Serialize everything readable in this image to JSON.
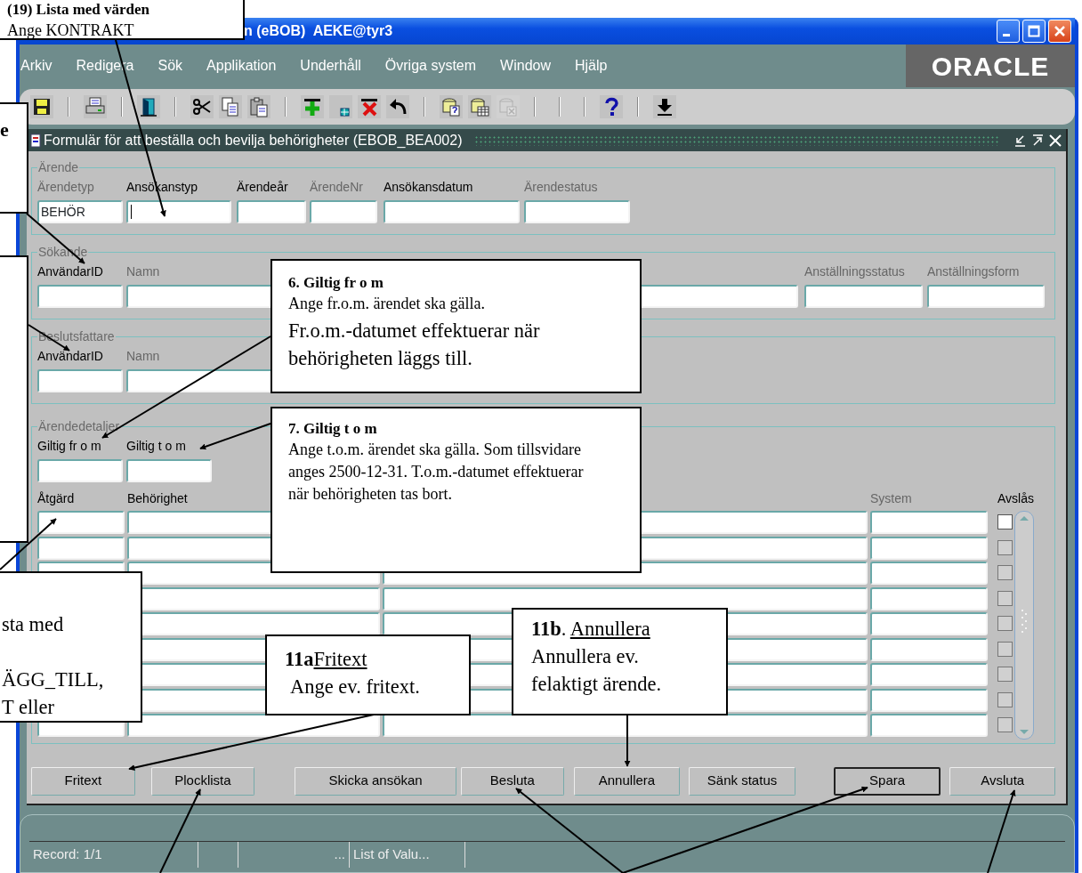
{
  "window": {
    "title": "n (eBOB)  AEKE@tyr3"
  },
  "menu": [
    "Arkiv",
    "Redigera",
    "Sök",
    "Applikation",
    "Underhåll",
    "Övriga system",
    "Window",
    "Hjälp"
  ],
  "logo": "ORACLE",
  "toolbar": [
    {
      "kind": "save",
      "disabled": false
    },
    {
      "kind": "separator"
    },
    {
      "kind": "print",
      "disabled": false
    },
    {
      "kind": "separator"
    },
    {
      "kind": "exit",
      "disabled": false
    },
    {
      "kind": "separator"
    },
    {
      "kind": "cut",
      "disabled": false
    },
    {
      "kind": "copy",
      "disabled": false
    },
    {
      "kind": "paste",
      "disabled": false
    },
    {
      "kind": "separator"
    },
    {
      "kind": "insert",
      "disabled": false
    },
    {
      "kind": "clear",
      "disabled": false
    },
    {
      "kind": "delete",
      "disabled": false
    },
    {
      "kind": "undo",
      "disabled": false
    },
    {
      "kind": "separator"
    },
    {
      "kind": "query",
      "disabled": false
    },
    {
      "kind": "fetch",
      "disabled": false
    },
    {
      "kind": "cancel",
      "disabled": true
    },
    {
      "kind": "separator"
    },
    {
      "kind": "separator"
    },
    {
      "kind": "separator"
    },
    {
      "kind": "help",
      "disabled": false
    },
    {
      "kind": "separator"
    },
    {
      "kind": "download",
      "disabled": false
    }
  ],
  "form": {
    "title": "Formulär för att beställa och bevilja behörigheter (EBOB_BEA002)"
  },
  "sections": [
    {
      "legend": "Ärende",
      "fields": [
        {
          "label": "Ärendetyp",
          "dimmed": true,
          "value": "BEHÖR",
          "focused": false
        },
        {
          "label": "Ansökanstyp",
          "dimmed": false,
          "focused": true
        },
        {
          "label": "Ärendeår",
          "dimmed": false,
          "focused": false
        },
        {
          "label": "ÄrendeNr",
          "dimmed": true,
          "focused": false
        },
        {
          "label": "Ansökansdatum",
          "dimmed": false,
          "focused": false
        },
        {
          "label": "Ärendestatus",
          "dimmed": true,
          "focused": false
        }
      ]
    },
    {
      "legend": "Sökande",
      "fields": [
        {
          "label": "AnvändarID",
          "dimmed": false,
          "focused": false
        },
        {
          "label": "Namn",
          "dimmed": true,
          "focused": false
        },
        {
          "label": "Anställningsstatus",
          "dimmed": true,
          "focused": false
        },
        {
          "label": "Anställningsform",
          "dimmed": true,
          "focused": false
        }
      ]
    },
    {
      "legend": "Beslutsfattare",
      "fields": [
        {
          "label": "AnvändarID",
          "dimmed": false,
          "focused": false
        },
        {
          "label": "Namn",
          "dimmed": true,
          "focused": false
        }
      ]
    },
    {
      "legend": "Ärendedetaljer",
      "fields": [
        {
          "label": "Giltig fr o m",
          "dimmed": false,
          "focused": false
        },
        {
          "label": "Giltig t o m",
          "dimmed": false,
          "focused": false
        }
      ]
    }
  ],
  "table": {
    "columns": [
      {
        "label": "Åtgärd",
        "dimmed": false
      },
      {
        "label": "Behörighet",
        "dimmed": false
      },
      {
        "label": "System",
        "dimmed": true
      },
      {
        "label": "Avslås",
        "dimmed": false
      }
    ],
    "rows": [
      {
        "checked": false,
        "disabled": false
      },
      {
        "checked": false,
        "disabled": true
      },
      {
        "checked": false,
        "disabled": true
      },
      {
        "checked": false,
        "disabled": true
      },
      {
        "checked": false,
        "disabled": true
      },
      {
        "checked": false,
        "disabled": true
      },
      {
        "checked": false,
        "disabled": true
      },
      {
        "checked": false,
        "disabled": true
      },
      {
        "checked": false,
        "disabled": true
      }
    ]
  },
  "buttons": [
    {
      "label": "Fritext",
      "focused": false
    },
    {
      "label": "Plocklista",
      "focused": false
    },
    {
      "label": "Skicka ansökan",
      "focused": false
    },
    {
      "label": "Besluta",
      "focused": false
    },
    {
      "label": "Annullera",
      "focused": false
    },
    {
      "label": "Sänk status",
      "focused": false
    },
    {
      "label": "Spara",
      "focused": true
    },
    {
      "label": "Avsluta",
      "focused": false
    }
  ],
  "status_bar": {
    "record": "Record: 1/1",
    "ellipsis": "...",
    "list": "List of Valu..."
  },
  "callouts": [
    {
      "kind": "note",
      "lines": [
        {
          "kind": "heading",
          "text": "(19) Lista med värden"
        },
        {
          "kind": "body",
          "text": "Ange KONTRAKT"
        }
      ]
    },
    {
      "kind": "note",
      "lines": [
        {
          "kind": "heading",
          "text": "e"
        }
      ]
    },
    {
      "kind": "blank"
    },
    {
      "kind": "note",
      "lines": [
        {
          "kind": "heading",
          "text": "6. Giltig fr o m"
        },
        {
          "kind": "body",
          "text": "Ange fr.o.m. ärendet ska gälla."
        },
        {
          "kind": "large",
          "text": "Fr.o.m.-datumet effektuerar när behörigheten läggs till."
        }
      ]
    },
    {
      "kind": "note",
      "lines": [
        {
          "kind": "heading",
          "text": "7. Giltig t o m"
        },
        {
          "kind": "body",
          "text": "Ange t.o.m. ärendet ska gälla. Som tillsvidare anges 2500-12-31. T.o.m.-datumet effektuerar när behörigheten tas bort."
        }
      ]
    },
    {
      "kind": "note",
      "lines": [
        {
          "kind": "large",
          "text": "sta med"
        },
        {
          "kind": "large",
          "text": "ÄGG_TILL,"
        },
        {
          "kind": "large",
          "text": "T eller"
        }
      ]
    },
    {
      "kind": "note",
      "lines": [
        {
          "kind": "numbered",
          "number": "11a",
          "title": "Fritext"
        },
        {
          "kind": "large",
          "text": "Ange ev. fritext."
        }
      ]
    },
    {
      "kind": "note",
      "lines": [
        {
          "kind": "numbered",
          "number": "11b",
          "separator": ".",
          "title": "Annullera"
        },
        {
          "kind": "large",
          "text": "Annullera ev. felaktigt ärende."
        }
      ]
    }
  ]
}
